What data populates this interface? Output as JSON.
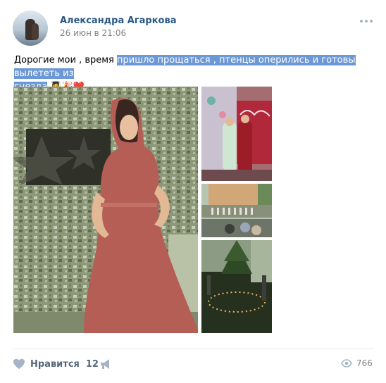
{
  "post": {
    "author": "Александра Агаркова",
    "date": "26 июн в 21:06",
    "text_plain": "Дорогие мои , время ",
    "text_selected_1": "пришло прощаться , птенцы оперились и готовы вылететь из",
    "text_selected_2": "гнезда",
    "emojis": "👩‍🎓🎉❤️"
  },
  "photos": [
    {
      "name": "main-photo",
      "description_icon": "photo"
    },
    {
      "name": "photo-graduation-stage"
    },
    {
      "name": "photo-school-courtyard"
    },
    {
      "name": "photo-night-candles"
    }
  ],
  "footer": {
    "like_label": "Нравится",
    "like_count": "12",
    "views_count": "766"
  },
  "colors": {
    "accent": "#2a5885",
    "selection": "#6d98d6",
    "muted": "#828282",
    "icon": "#a5b4c6"
  }
}
